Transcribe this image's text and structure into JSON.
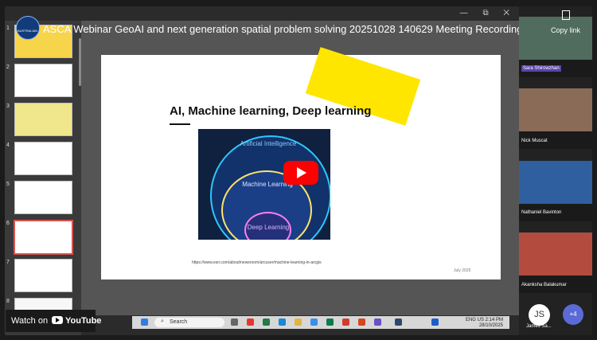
{
  "window": {
    "title": "ASCA Webinar GeoAI and next generation spatial problem solving 20251028 140629 Meeting Recording"
  },
  "logo": {
    "text": "AUSTRALIAN"
  },
  "copy_link": {
    "label": "Copy link"
  },
  "slides": [
    {
      "number": "1"
    },
    {
      "number": "2"
    },
    {
      "number": "3"
    },
    {
      "number": "4"
    },
    {
      "number": "5"
    },
    {
      "number": "6"
    },
    {
      "number": "7"
    },
    {
      "number": "8"
    }
  ],
  "main_slide": {
    "title": "AI, Machine learning, Deep learning",
    "diagram": {
      "outer": "Artificial Intelligence",
      "middle": "Machine Learning",
      "inner": "Deep Learning"
    },
    "url": "https://www.esri.com/about/newsroom/arcuser/machine-learning-in-arcgis",
    "date": "July 2025"
  },
  "participants": [
    {
      "name": "Sara Shirowzhan"
    },
    {
      "name": "Nick Muscat"
    },
    {
      "name": "Nathaniel Bavinton"
    },
    {
      "name": "Akanksha Balakumar"
    },
    {
      "name": "James Sa..."
    }
  ],
  "more_participants": {
    "label": "+4"
  },
  "taskbar": {
    "search_placeholder": "Search",
    "language": "ENG",
    "region": "US",
    "time": "2:14 PM",
    "date": "28/10/2025"
  },
  "watch_on": {
    "label": "Watch on",
    "brand": "YouTube"
  },
  "avatar": {
    "initials": "JS"
  }
}
